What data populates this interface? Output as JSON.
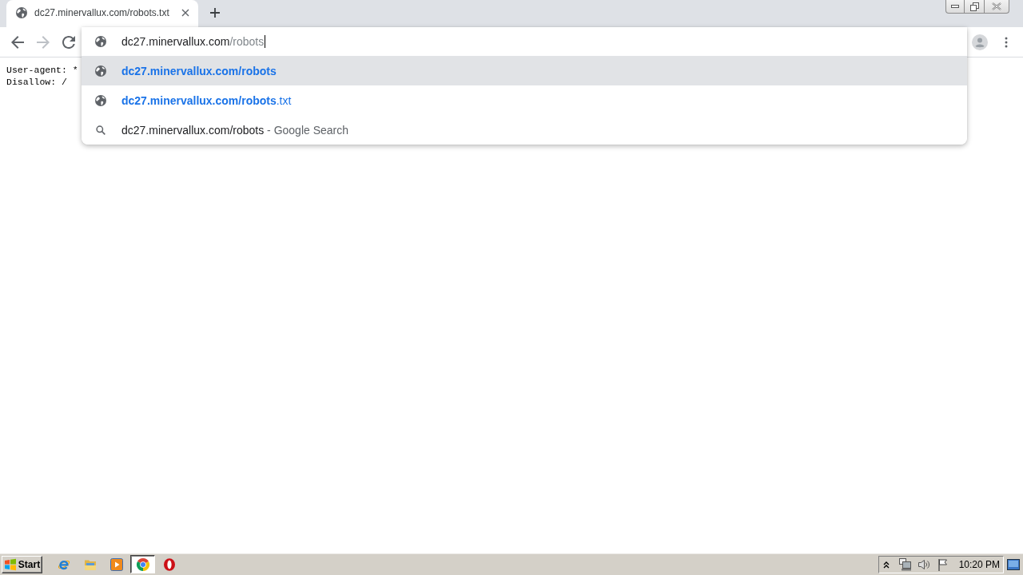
{
  "tab_strip": {
    "tabs": [
      {
        "title": "dc27.minervallux.com/robots.txt",
        "selected": true
      }
    ]
  },
  "toolbar": {
    "back": {
      "disabled": false
    },
    "forward": {
      "disabled": true
    }
  },
  "omnibox": {
    "value": "dc27.minervallux.com",
    "inline_autocomplete": "/robots",
    "suggestions": [
      {
        "kind": "url",
        "match": "dc27.minervallux.com/robots",
        "selected": true
      },
      {
        "kind": "url",
        "match": "dc27.minervallux.com/robots",
        "rest": ".txt",
        "selected": false
      },
      {
        "kind": "search",
        "match": "dc27.minervallux.com/robots",
        "rest": "- Google Search",
        "selected": false
      }
    ]
  },
  "page": {
    "lines": [
      "User-agent: *",
      "Disallow: /"
    ]
  },
  "taskbar": {
    "start": "Start",
    "apps": [
      {
        "kind": "internet-explorer",
        "selected": false
      },
      {
        "kind": "file-explorer",
        "selected": false
      },
      {
        "kind": "media-player",
        "selected": false
      },
      {
        "kind": "chrome",
        "selected": true
      },
      {
        "kind": "opera",
        "selected": false
      }
    ],
    "clock": "10:20 PM"
  }
}
